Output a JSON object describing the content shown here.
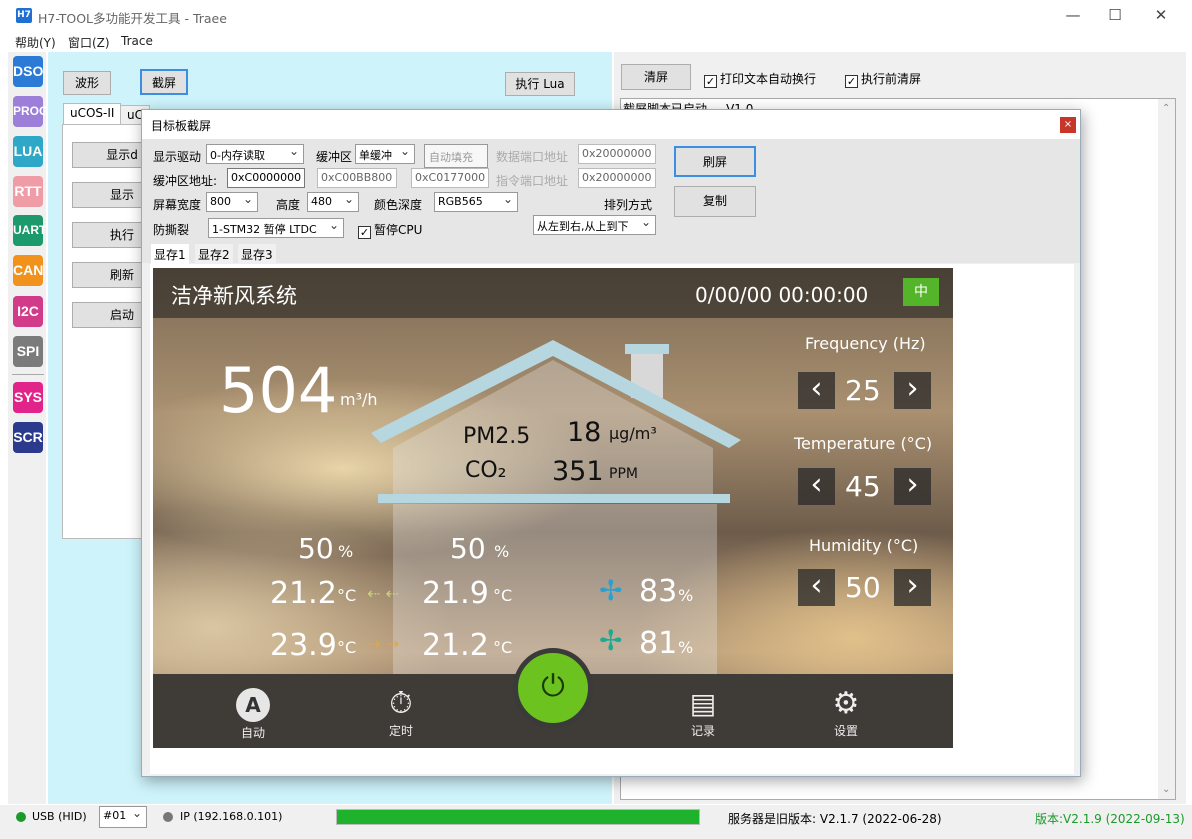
{
  "window": {
    "title": "H7-TOOL多功能开发工具 - Traee",
    "icon": "H7"
  },
  "menu": [
    "帮助(Y)",
    "窗口(Z)",
    "Trace"
  ],
  "sidebar": [
    {
      "label": "DSO",
      "color": "#2a7ad6"
    },
    {
      "label": "PROG",
      "color": "#9b7fd8"
    },
    {
      "label": "LUA",
      "color": "#2fa8c8"
    },
    {
      "label": "RTT",
      "color": "#f09ca6"
    },
    {
      "label": "UART",
      "color": "#1d9a6c"
    },
    {
      "label": "CAN",
      "color": "#f0921c"
    },
    {
      "label": "I2C",
      "color": "#d23a8a"
    },
    {
      "label": "SPI",
      "color": "#7b7b7b"
    },
    {
      "label": "SYS",
      "color": "#e2238a"
    },
    {
      "label": "SCR",
      "color": "#2b3a8c"
    }
  ],
  "left": {
    "btn_wave": "波形",
    "btn_screenshot": "截屏",
    "btn_run_lua": "执行 Lua",
    "tabs": [
      "uCOS-II",
      "uC"
    ],
    "buttons": [
      "显示d",
      "显示",
      "执行",
      "刷新",
      "启动"
    ]
  },
  "right": {
    "btn_clear": "清屏",
    "chk_wrap": "打印文本自动换行",
    "chk_clear": "执行前清屏",
    "log_line": "截屏脚本已启动 ... V1.0"
  },
  "dialog": {
    "title": "目标板截屏",
    "display_driver_label": "显示驱动",
    "display_driver": "0-内存读取",
    "buffer_label": "缓冲区",
    "buffer": "单缓冲",
    "btn_autofill": "自动填充",
    "data_port_label": "数据端口地址",
    "data_port": "0x20000000",
    "buf_addr_label": "缓冲区地址:",
    "buf_addr": "0xC0000000",
    "buf_addr2": "0xC00BB800",
    "buf_addr3": "0xC0177000",
    "cmd_port_label": "指令端口地址",
    "cmd_port": "0x20000000",
    "width_label": "屏幕宽度",
    "width": "800",
    "height_label": "高度",
    "height": "480",
    "depth_label": "颜色深度",
    "depth": "RGB565",
    "order_label": "排列方式",
    "order": "从左到右,从上到下",
    "tear_label": "防撕裂",
    "tear": "1-STM32 暂停 LTDC",
    "pause_cpu": "暂停CPU",
    "btn_refresh": "刷屏",
    "btn_copy": "复制",
    "tabs": [
      "显存1",
      "显存2",
      "显存3"
    ]
  },
  "lcd": {
    "title": "洁净新风系统",
    "datetime": "0/00/00 00:00:00",
    "lang": "中",
    "airflow": "504",
    "airflow_unit": "m³/h",
    "pm_label": "PM2.5",
    "pm_value": "18",
    "pm_unit": "μg/m³",
    "co2_label": "CO₂",
    "co2_value": "351",
    "co2_unit": "PPM",
    "hum_left": "50",
    "hum_mid": "50",
    "pct": "%",
    "temp1_left": "21.2",
    "temp1_mid": "21.9",
    "temp2_left": "23.9",
    "temp2_mid": "21.2",
    "degc": "°C",
    "fan1": "83",
    "fan2": "81",
    "freq_label": "Frequency (Hz)",
    "freq_value": "25",
    "temp_label": "Temperature (°C)",
    "temp_value": "45",
    "humid_label": "Humidity (°C)",
    "humid_value": "50",
    "nav": [
      "自动",
      "定时",
      "记录",
      "设置"
    ],
    "colors": {
      "power": "#6cc21f",
      "lang_badge": "#55b52a",
      "fan": "#2aa0d0"
    }
  },
  "status": {
    "usb": "USB (HID)",
    "device": "#01",
    "ip": "IP (192.168.0.101)",
    "server": "服务器是旧版本: V2.1.7 (2022-06-28)",
    "version": "版本:V2.1.9 (2022-09-13)",
    "progress": 1.0
  }
}
